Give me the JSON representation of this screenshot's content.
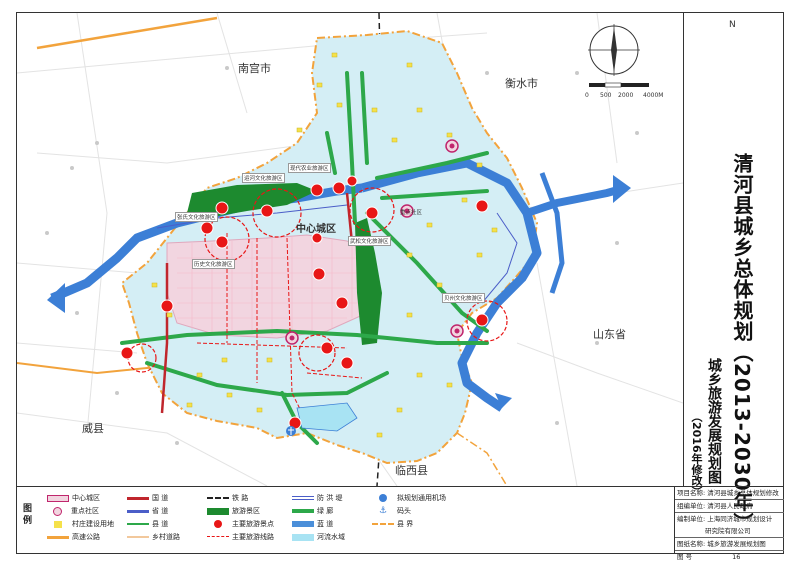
{
  "title": {
    "main": "清河县城乡总体规划（2013-2030年）",
    "edition": "（2016年修改）",
    "sub": "城乡旅游发展规划图"
  },
  "compass": {
    "north": "N",
    "scale": [
      "0",
      "500",
      "2000",
      "4000M"
    ]
  },
  "map_labels": {
    "nangong": "南宫市",
    "hengshui": "衡水市",
    "weixian": "威县",
    "linxi": "临西县",
    "shandong": "山东省",
    "center": "中心城区"
  },
  "scenic_labels": [
    "历史文化旅游区",
    "运河文化旅游区",
    "武松文化旅游区",
    "现代农业旅游区",
    "张氏文化旅游区",
    "贝州文化旅游区",
    "重点社区"
  ],
  "legend": {
    "heading": "图  例",
    "items": [
      {
        "id": "center-area",
        "label": "中心城区"
      },
      {
        "id": "key-community",
        "label": "重点社区"
      },
      {
        "id": "village-land",
        "label": "村庄建设用地"
      },
      {
        "id": "expressway",
        "label": "高速公路"
      },
      {
        "id": "national-road",
        "label": "国    道"
      },
      {
        "id": "provincial-road",
        "label": "省    道"
      },
      {
        "id": "county-road",
        "label": "县    道"
      },
      {
        "id": "rural-road",
        "label": "乡村道路"
      },
      {
        "id": "railway",
        "label": "铁    路"
      },
      {
        "id": "tourism-area",
        "label": "旅游景区"
      },
      {
        "id": "main-spot",
        "label": "主要旅游景点"
      },
      {
        "id": "main-route",
        "label": "主要旅游线路"
      },
      {
        "id": "embankment",
        "label": "防 洪 堤"
      },
      {
        "id": "greenway",
        "label": "绿    廊"
      },
      {
        "id": "blueway",
        "label": "蓝    道"
      },
      {
        "id": "river",
        "label": "河流水域"
      },
      {
        "id": "airport",
        "label": "拟规划通用机场"
      },
      {
        "id": "pier",
        "label": "码头"
      },
      {
        "id": "county-boundary",
        "label": "县    界"
      }
    ]
  },
  "info": {
    "project_label": "项目名称:",
    "project": "清河县城乡总体规划修改",
    "org_label": "组编单位:",
    "org": "清河县人民政府",
    "designer_label": "编制单位:",
    "designer": "上海同济城市规划设计",
    "designer2": "研究院有限公司",
    "drawing_label": "图纸名称:",
    "drawing": "城乡旅游发展规划图",
    "no_label": "图    号",
    "no": "16"
  },
  "colors": {
    "county_fill": "#d4eef5",
    "center_fill": "#f2d5e0",
    "river": "#3c7fd6",
    "greenway": "#2da84a",
    "tourism_area": "#1d8a2f",
    "spot": "#e81616",
    "national_road": "#c0262d",
    "expressway": "#f2a33c"
  }
}
